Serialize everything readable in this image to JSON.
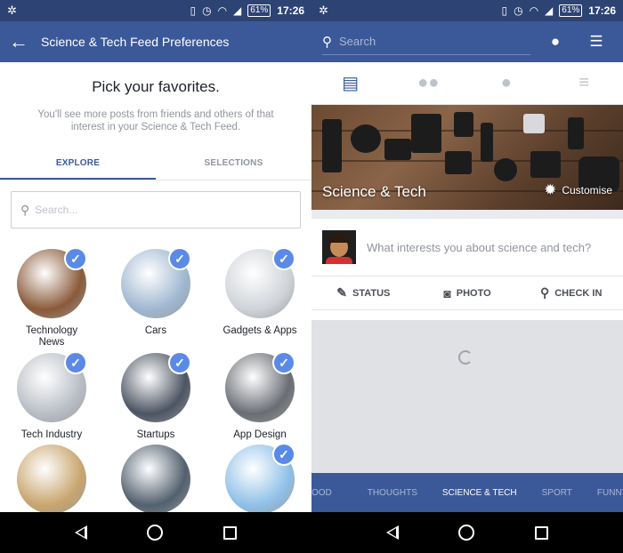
{
  "status": {
    "battery": "61%",
    "time": "17:26"
  },
  "left": {
    "header_title": "Science & Tech Feed Preferences",
    "pick_title": "Pick your favorites.",
    "pick_subtitle": "You'll see more posts from friends and others of that interest in your Science & Tech Feed.",
    "tabs": [
      {
        "label": "EXPLORE"
      },
      {
        "label": "SELECTIONS"
      }
    ],
    "search_placeholder": "Search...",
    "topics": [
      {
        "label": "Technology News",
        "checked": true,
        "color": "#8a5a3a"
      },
      {
        "label": "Cars",
        "checked": true,
        "color": "#9fb7d1"
      },
      {
        "label": "Gadgets & Apps",
        "checked": true,
        "color": "#cfd3d8"
      },
      {
        "label": "Tech Industry",
        "checked": true,
        "color": "#b9bec6"
      },
      {
        "label": "Startups",
        "checked": true,
        "color": "#4c5563"
      },
      {
        "label": "App Design",
        "checked": true,
        "color": "#6a6e74"
      },
      {
        "label": "",
        "checked": false,
        "color": "#c9a56e"
      },
      {
        "label": "",
        "checked": false,
        "color": "#52606f"
      },
      {
        "label": "",
        "checked": true,
        "color": "#8fc0e8"
      }
    ]
  },
  "right": {
    "search_placeholder": "Search",
    "cover_title": "Science & Tech",
    "customise_label": "Customise",
    "composer_prompt": "What interests you about science and tech?",
    "actions": [
      {
        "label": "STATUS",
        "icon": "pencil-icon"
      },
      {
        "label": "PHOTO",
        "icon": "camera-icon"
      },
      {
        "label": "CHECK IN",
        "icon": "location-pin-icon"
      }
    ],
    "topic_bar": [
      "OOD",
      "THOUGHTS",
      "SCIENCE & TECH",
      "SPORT",
      "FUNNY"
    ],
    "active_topic": "SCIENCE & TECH"
  },
  "colors": {
    "brand": "#3b5998",
    "status_bar": "#2d4373",
    "check": "#5b8ae6"
  }
}
